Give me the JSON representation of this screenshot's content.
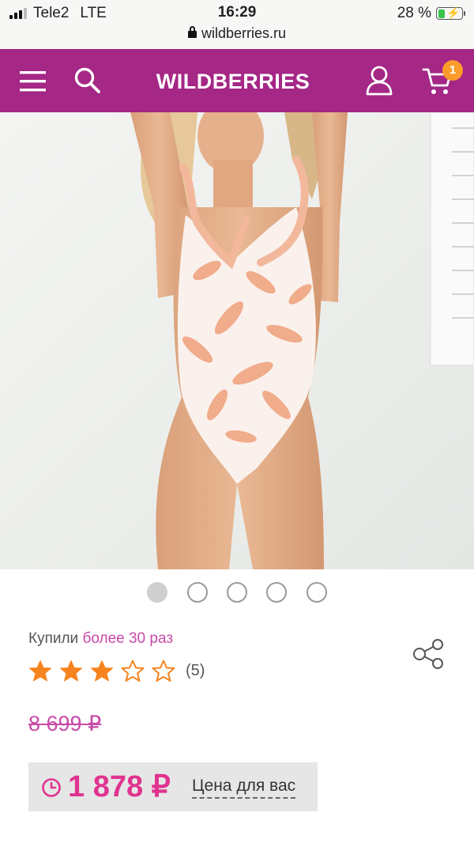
{
  "status_bar": {
    "carrier": "Tele2",
    "network": "LTE",
    "time": "16:29",
    "battery": "28 %",
    "battery_level": 0.28,
    "url": "wildberries.ru"
  },
  "header": {
    "logo": "WILDBERRIES",
    "cart_count": "1",
    "brand_color": "#a52786",
    "badge_color": "#f99c2c"
  },
  "gallery": {
    "image_count": 5,
    "active_index": 0
  },
  "product": {
    "bought_prefix": "Купили",
    "bought_value": "более 30 раз",
    "rating": 3,
    "max_rating": 5,
    "review_count": "(5)",
    "old_price": "8 699 ₽",
    "price": "1 878 ₽",
    "price_label": "Цена для вас",
    "price_color": "#e0338f",
    "accent_color": "#c84aa8",
    "star_color": "#f5841f"
  }
}
